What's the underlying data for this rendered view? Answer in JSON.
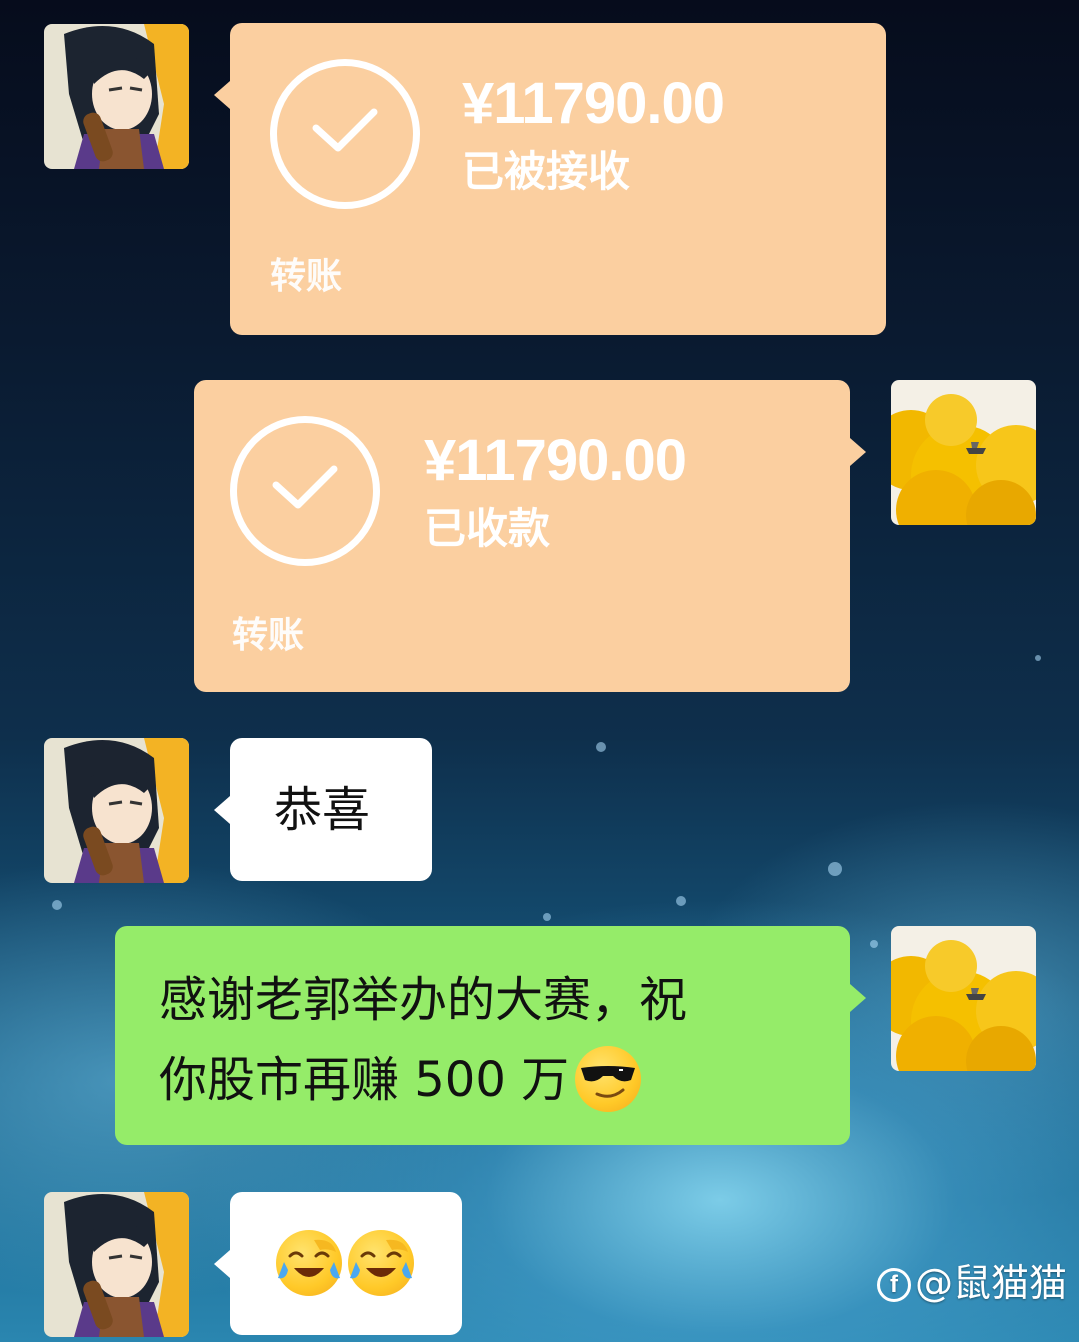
{
  "messages": [
    {
      "type": "transfer",
      "amount": "¥11790.00",
      "status": "已被接收",
      "label": "转账"
    },
    {
      "type": "transfer",
      "amount": "¥11790.00",
      "status": "已收款",
      "label": "转账"
    },
    {
      "type": "text",
      "text": "恭喜"
    },
    {
      "type": "text",
      "lines": [
        "感谢老郭举办的大赛，祝",
        "你股市再赚 500 万"
      ],
      "emoji": "sunglasses-emoji"
    },
    {
      "type": "emoji",
      "emojis": [
        "laugh-cry-emoji",
        "laugh-cry-emoji"
      ]
    }
  ],
  "watermark": {
    "logo": "f",
    "text": "@鼠猫猫"
  },
  "colors": {
    "transfer_bg": "#fbcfa0",
    "self_bubble": "#95ec69",
    "other_bubble": "#ffffff"
  }
}
